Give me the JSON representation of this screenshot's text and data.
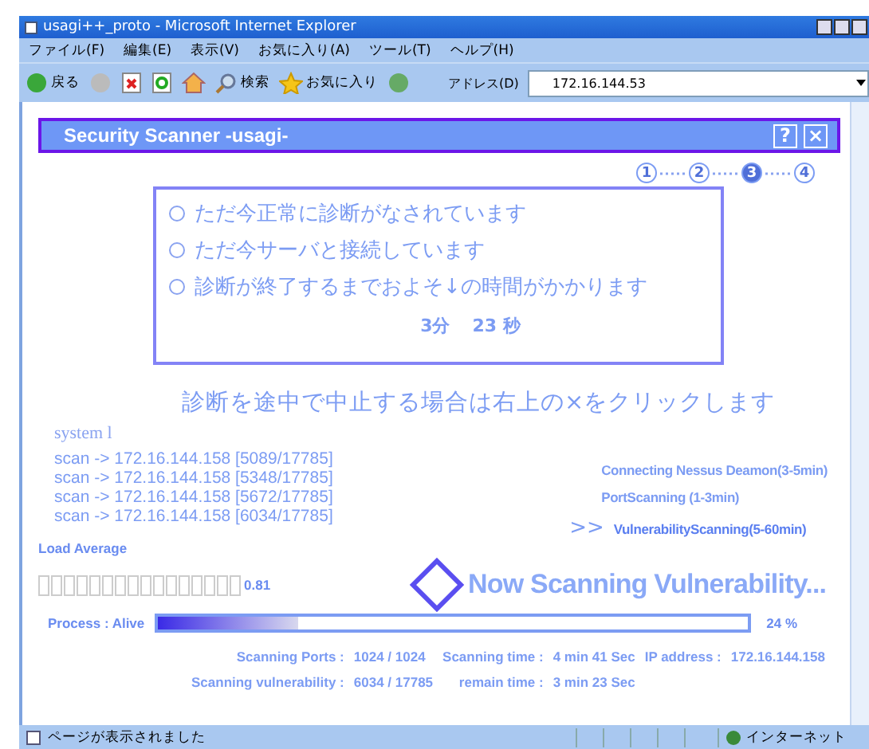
{
  "window": {
    "title": "usagi++_proto - Microsoft Internet Explorer"
  },
  "menu": [
    "ファイル(F)",
    "編集(E)",
    "表示(V)",
    "お気に入り(A)",
    "ツール(T)",
    "ヘルプ(H)"
  ],
  "toolbar": {
    "back": "戻る",
    "search": "検索",
    "favorites": "お気に入り",
    "address_label": "アドレス(D)",
    "address": "172.16.144.53"
  },
  "app": {
    "title": "Security Scanner -usagi-",
    "help": "?",
    "close": "×"
  },
  "steps": [
    {
      "label": "1",
      "selected": false
    },
    {
      "label": "2",
      "selected": false
    },
    {
      "label": "3",
      "selected": true
    },
    {
      "label": "4",
      "selected": false
    }
  ],
  "messages": [
    "ただ今正常に診断がなされています",
    "ただ今サーバと接続しています",
    "診断が終了するまでおよそ↓の時間がかかります"
  ],
  "eta": {
    "minutes": "3分",
    "seconds": "23 秒"
  },
  "notice": "診断を途中で中止する場合は右上の×をクリックします",
  "system_label": "system l",
  "log": [
    "scan -> 172.16.144.158 [5089/17785]",
    "scan -> 172.16.144.158 [5348/17785]",
    "scan -> 172.16.144.158 [5672/17785]",
    "scan -> 172.16.144.158 [6034/17785]"
  ],
  "phases": [
    {
      "label": "Connecting Nessus Deamon(3-5min)",
      "selected": false
    },
    {
      "label": "PortScanning (1-3min)",
      "selected": false
    },
    {
      "label": "VulnerabilityScanning(5-60min)",
      "selected": true
    }
  ],
  "phase_marker": ">>",
  "load": {
    "label": "Load Average",
    "reading": "0.81"
  },
  "process": "Process : Alive",
  "status_heading": "Now Scanning Vulnerability...",
  "progress": {
    "level": 0.24,
    "reading": "24 %"
  },
  "stats": [
    {
      "label": "Scanning Ports :",
      "value": "1024 / 1024"
    },
    {
      "label": "Scanning time :",
      "value": "4 min 41 Sec"
    },
    {
      "label": "IP address :",
      "value": "172.16.144.158"
    },
    {
      "label": "Scanning vulnerability :",
      "value": "6034 / 17785"
    },
    {
      "label": "remain time :",
      "value": "3 min 23 Sec"
    }
  ],
  "status_bar": {
    "text": "ページが表示されました",
    "zone": "インターネット"
  }
}
